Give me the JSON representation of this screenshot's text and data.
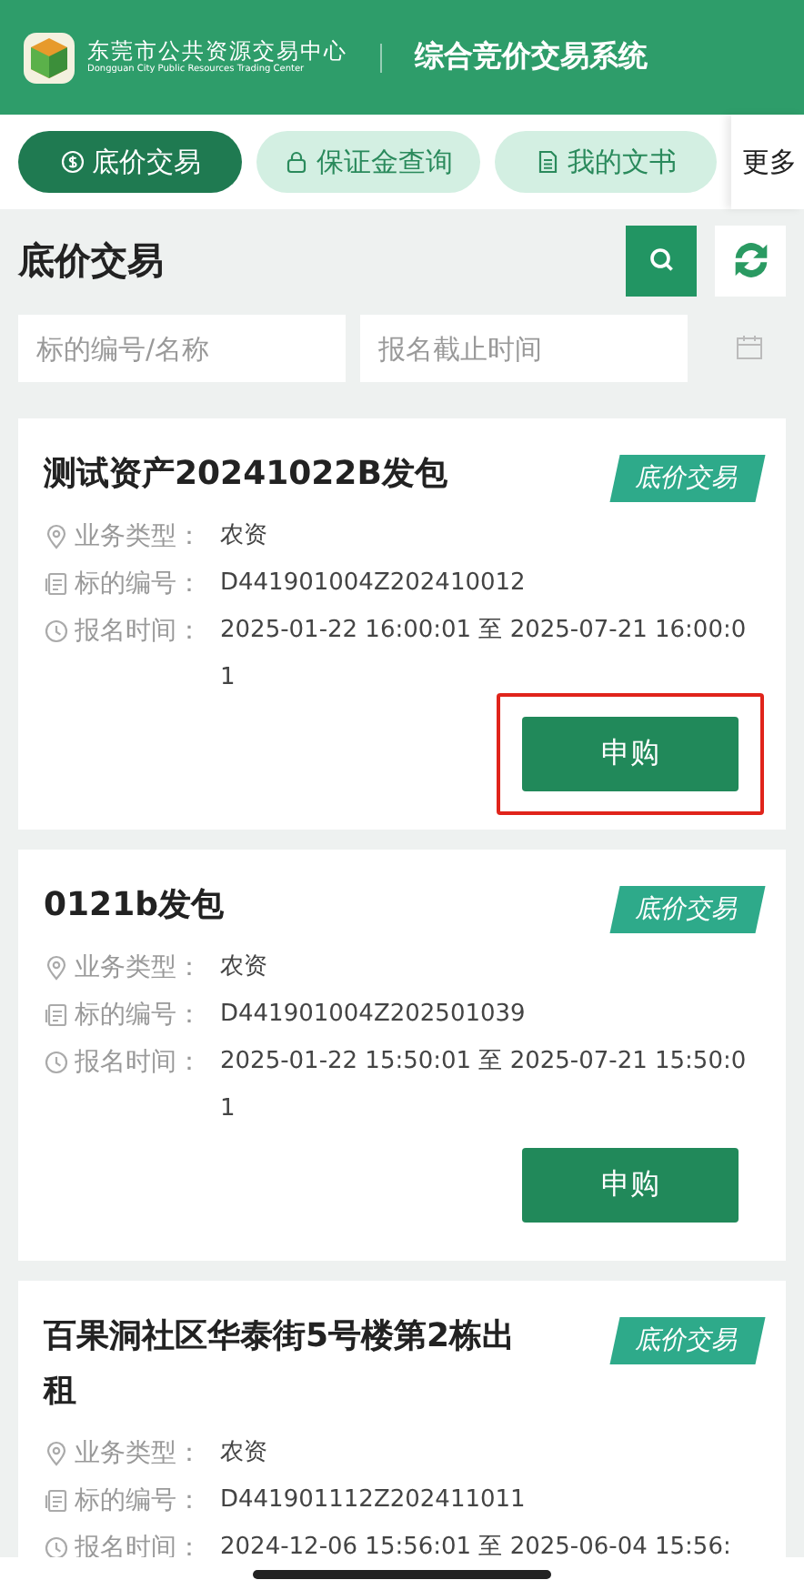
{
  "header": {
    "org_name": "东莞市公共资源交易中心",
    "org_name_en": "Dongguan City Public Resources Trading Center",
    "system_title": "综合竞价交易系统"
  },
  "tabs": [
    {
      "label": "底价交易",
      "kind": "pill",
      "selected": true
    },
    {
      "label": "保证金查询",
      "kind": "pill",
      "selected": false
    },
    {
      "label": "我的文书",
      "kind": "pill",
      "selected": false
    },
    {
      "label": "更多",
      "kind": "plain",
      "selected": false
    }
  ],
  "page_title": "底价交易",
  "filters": {
    "keyword": {
      "placeholder": "标的编号/名称"
    },
    "deadline": {
      "placeholder": "报名截止时间"
    }
  },
  "cards": [
    {
      "title": "测试资产20241022B发包",
      "tag": "底价交易",
      "fields": [
        {
          "label": "业务类型：",
          "value": "农资"
        },
        {
          "label": "标的编号：",
          "value": "D441901004Z202410012"
        },
        {
          "label": "报名时间：",
          "value": "2025-01-22 16:00:01 至 2025-07-21 16:00:01"
        }
      ],
      "button": "申购",
      "highlighted": true
    },
    {
      "title": "0121b发包",
      "tag": "底价交易",
      "fields": [
        {
          "label": "业务类型：",
          "value": "农资"
        },
        {
          "label": "标的编号：",
          "value": "D441901004Z202501039"
        },
        {
          "label": "报名时间：",
          "value": "2025-01-22 15:50:01 至 2025-07-21 15:50:01"
        }
      ],
      "button": "申购",
      "highlighted": false
    },
    {
      "title": "百果洞社区华泰街5号楼第2栋出租",
      "tag": "底价交易",
      "fields": [
        {
          "label": "业务类型：",
          "value": "农资"
        },
        {
          "label": "标的编号：",
          "value": "D441901112Z202411011"
        },
        {
          "label": "报名时间：",
          "value": "2024-12-06 15:56:01 至 2025-06-04 15:56:"
        }
      ]
    }
  ]
}
